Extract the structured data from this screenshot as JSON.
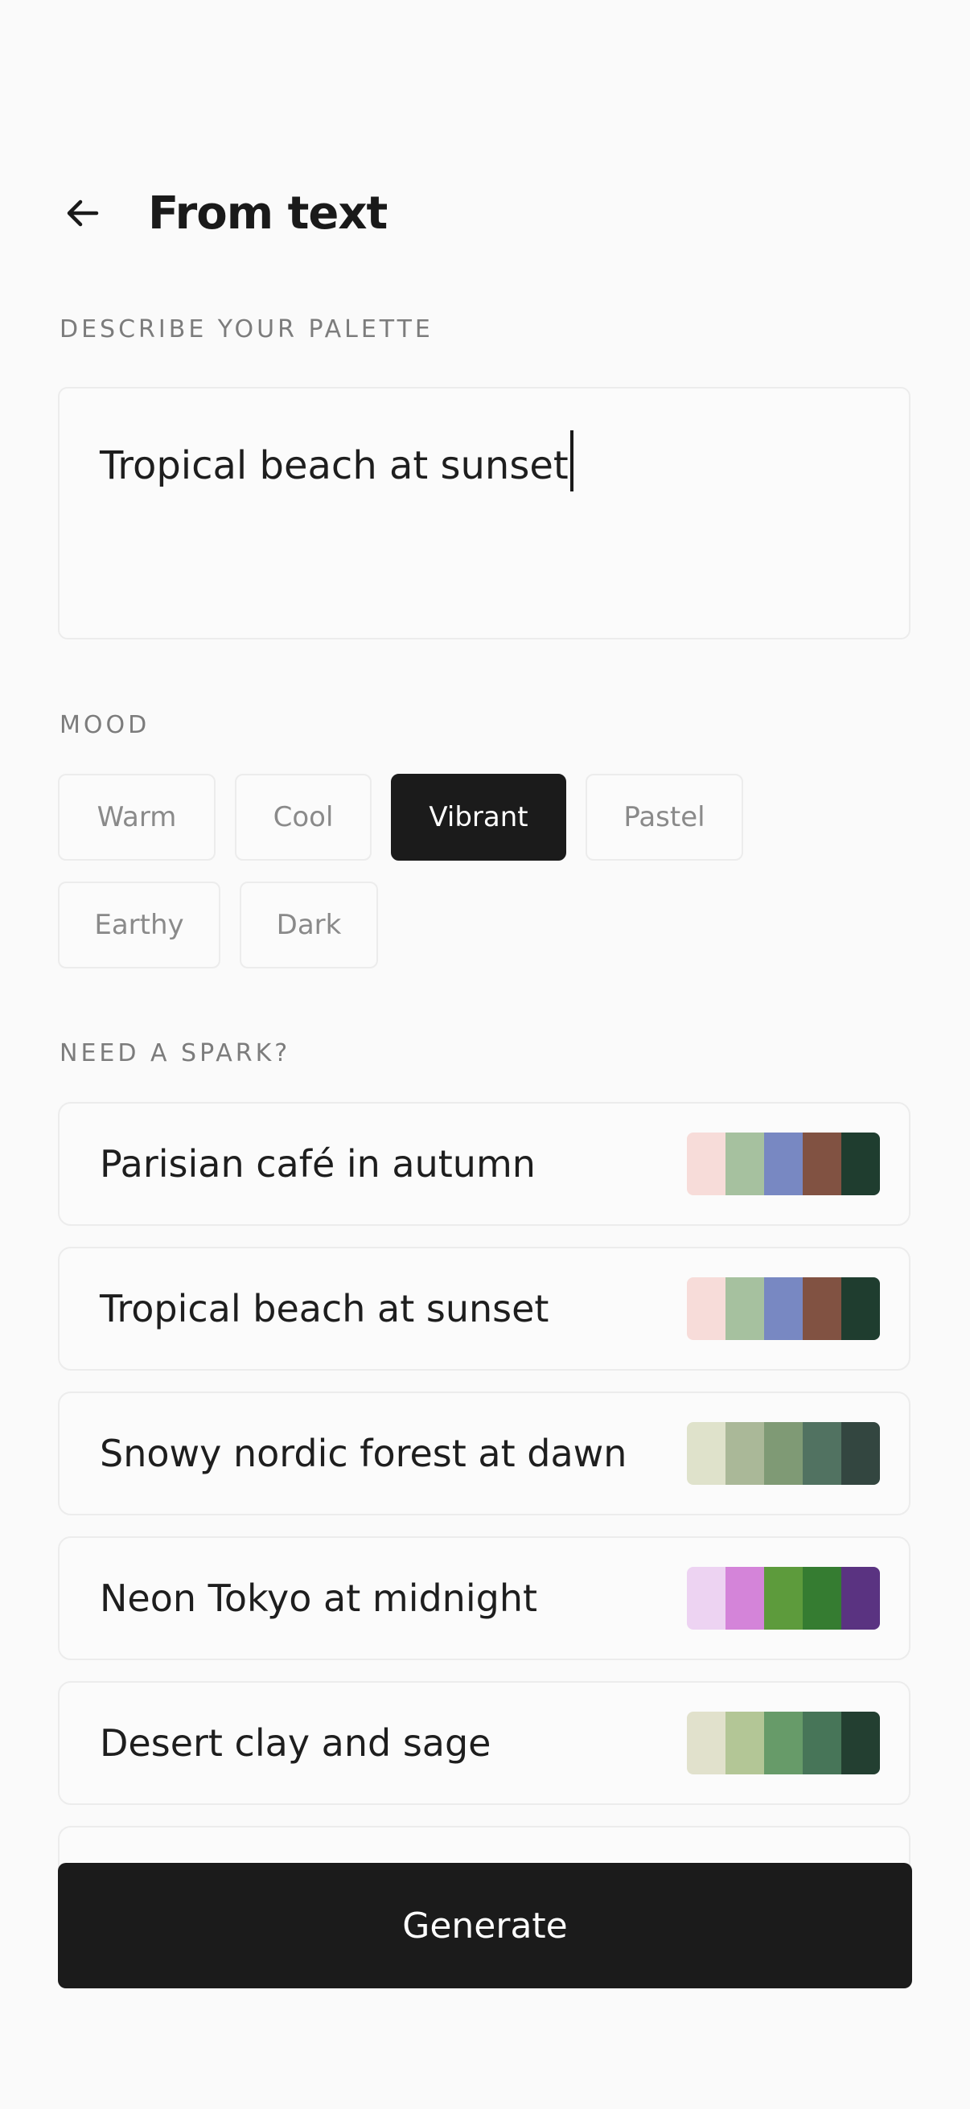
{
  "header": {
    "title": "From text",
    "back_icon": "arrow-left-icon"
  },
  "describe": {
    "label": "DESCRIBE YOUR PALETTE",
    "value": "Tropical beach at sunset"
  },
  "mood": {
    "label": "MOOD",
    "options": [
      {
        "label": "Warm",
        "selected": false
      },
      {
        "label": "Cool",
        "selected": false
      },
      {
        "label": "Vibrant",
        "selected": true
      },
      {
        "label": "Pastel",
        "selected": false
      },
      {
        "label": "Earthy",
        "selected": false
      },
      {
        "label": "Dark",
        "selected": false
      }
    ]
  },
  "spark": {
    "label": "NEED A SPARK?",
    "items": [
      {
        "label": "Parisian café in autumn",
        "colors": [
          "#f7dcd9",
          "#a6c19f",
          "#7888c2",
          "#815242",
          "#1f3d2f"
        ]
      },
      {
        "label": "Tropical beach at sunset",
        "colors": [
          "#f7dcd9",
          "#a6c19f",
          "#7888c2",
          "#815242",
          "#1f3d2f"
        ]
      },
      {
        "label": "Snowy nordic forest at dawn",
        "colors": [
          "#dfe2cb",
          "#aab898",
          "#7f9a75",
          "#517261",
          "#334640"
        ]
      },
      {
        "label": "Neon Tokyo at midnight",
        "colors": [
          "#edd3f2",
          "#d484d9",
          "#5d9b3c",
          "#357c31",
          "#5a3381"
        ]
      },
      {
        "label": "Desert clay and sage",
        "colors": [
          "#e1e1cc",
          "#b3c696",
          "#679b69",
          "#477558",
          "#233f31"
        ]
      }
    ]
  },
  "generate": {
    "label": "Generate"
  }
}
